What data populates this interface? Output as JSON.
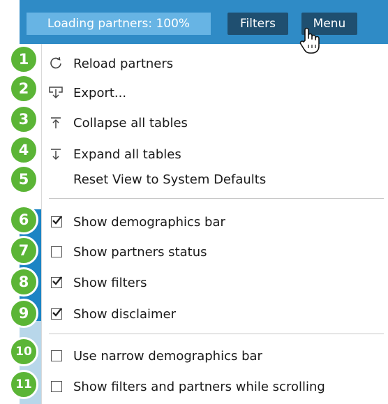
{
  "topbar": {
    "loading_label": "Loading partners: 100%",
    "filters_label": "Filters",
    "menu_label": "Menu"
  },
  "menu": {
    "actions": [
      {
        "label": "Reload partners",
        "icon": "reload-icon"
      },
      {
        "label": "Export...",
        "icon": "export-icon"
      },
      {
        "label": "Collapse all tables",
        "icon": "collapse-icon"
      },
      {
        "label": "Expand all tables",
        "icon": "expand-icon"
      },
      {
        "label": "Reset View to System Defaults",
        "icon": ""
      }
    ],
    "toggles": [
      {
        "label": "Show demographics bar",
        "checked": true
      },
      {
        "label": "Show partners status",
        "checked": false
      },
      {
        "label": "Show filters",
        "checked": true
      },
      {
        "label": "Show disclaimer",
        "checked": true
      }
    ],
    "options": [
      {
        "label": "Use narrow demographics bar",
        "checked": false
      },
      {
        "label": "Show filters and partners while scrolling",
        "checked": false
      }
    ]
  },
  "badges": [
    "1",
    "2",
    "3",
    "4",
    "5",
    "6",
    "7",
    "8",
    "9",
    "10",
    "11"
  ],
  "colors": {
    "topbar": "#2f8bc6",
    "loading_bg": "#67b4e4",
    "button_bg": "#1f4f70",
    "badge": "#5bb536"
  }
}
